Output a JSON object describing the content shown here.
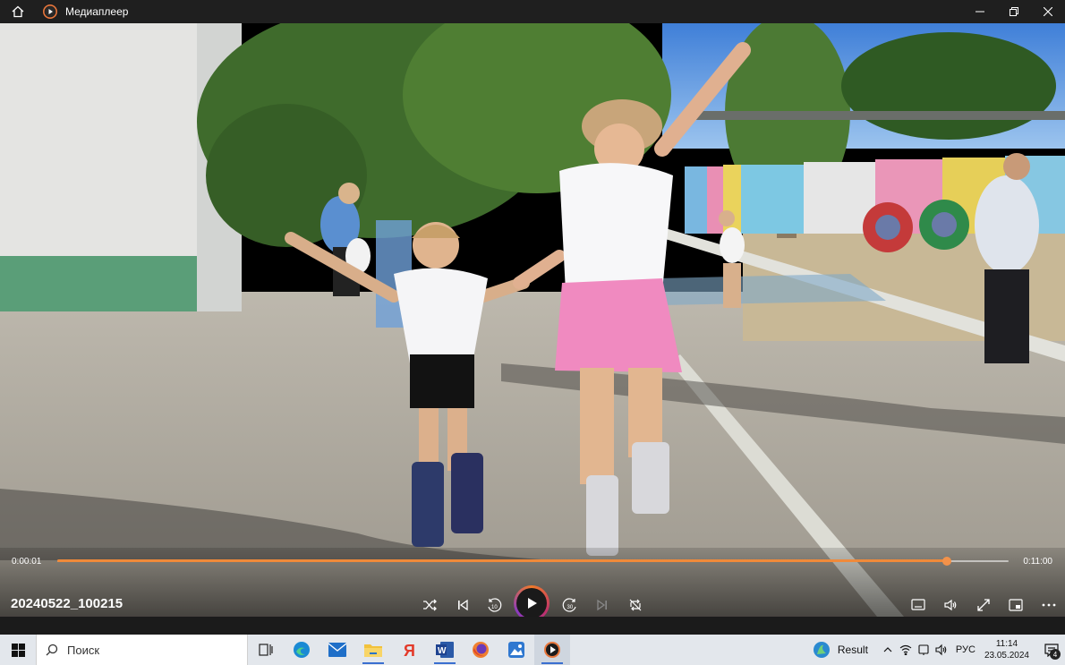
{
  "window": {
    "title": "Медиаплеер",
    "icons": {
      "home": "home-icon",
      "app": "media-player-icon",
      "minimize": "minimize-icon",
      "maximize": "restore-icon",
      "close": "close-icon"
    }
  },
  "player": {
    "elapsed": "0:00:01",
    "total": "0:11:00",
    "progress_fraction": 0.9355,
    "filename": "20240522_100215",
    "controls": [
      "shuffle-icon",
      "previous-icon",
      "rewind-10-icon",
      "play-icon",
      "forward-30-icon",
      "next-icon",
      "repeat-off-icon",
      "miniplayer-icon",
      "volume-icon",
      "fullscreen-icon",
      "picture-in-picture-icon",
      "more-icon"
    ],
    "accent": "#f08a3a"
  },
  "taskbar": {
    "search_placeholder": "Поиск",
    "apps": [
      "task-view-icon",
      "edge-icon",
      "mail-icon",
      "file-explorer-icon",
      "yandex-browser-icon",
      "word-icon",
      "firefox-icon",
      "photos-icon",
      "media-player-icon"
    ],
    "weather_label": "Result",
    "language": "РУС",
    "time": "11:14",
    "date": "23.05.2024",
    "notification_count": "4"
  }
}
